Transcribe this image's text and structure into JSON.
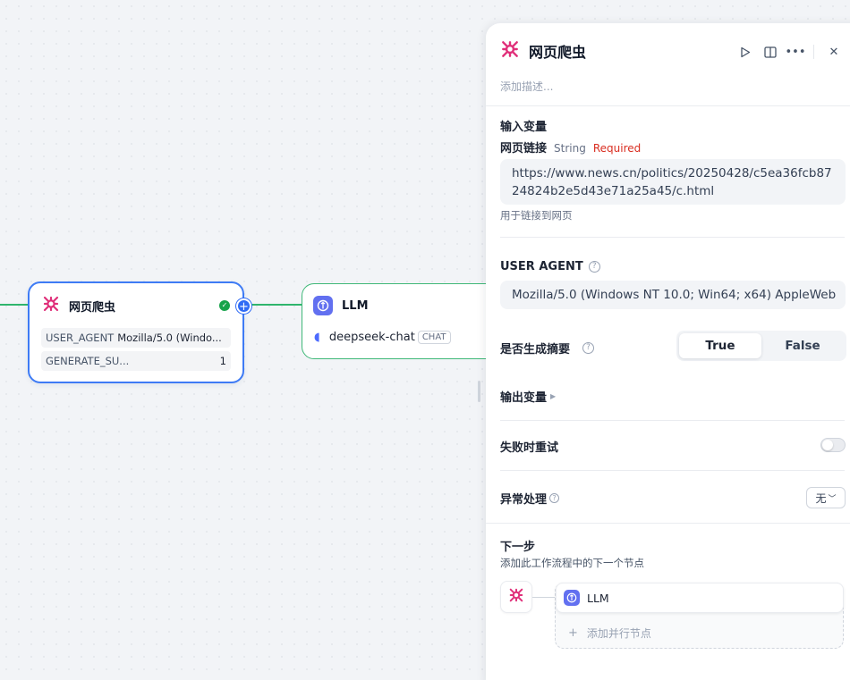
{
  "canvas": {
    "crawler_node": {
      "title": "网页爬虫",
      "status_icon": "check-circle-icon",
      "params": [
        {
          "key": "USER_AGENT",
          "value": "Mozilla/5.0 (Windo..."
        },
        {
          "key": "GENERATE_SU...",
          "value": "1"
        }
      ]
    },
    "llm_node": {
      "title": "LLM",
      "model": "deepseek-chat",
      "tag": "CHAT"
    }
  },
  "panel": {
    "title": "网页爬虫",
    "description_placeholder": "添加描述...",
    "input_section": "输入变量",
    "url_var": {
      "name": "网页链接",
      "type": "String",
      "required": "Required",
      "value": "https://www.news.cn/politics/20250428/c5ea36fcb8724824b2e5d43e71a25a45/c.html",
      "hint": "用于链接到网页"
    },
    "user_agent": {
      "label": "USER AGENT",
      "value": "Mozilla/5.0 (Windows NT 10.0; Win64; x64) AppleWeb"
    },
    "generate_summary": {
      "label": "是否生成摘要",
      "options": [
        "True",
        "False"
      ],
      "selected": "True"
    },
    "output_section": "输出变量",
    "retry_on_fail": {
      "label": "失败时重试",
      "enabled": false
    },
    "error_handling": {
      "label": "异常处理",
      "value": "无"
    },
    "next_step": {
      "title": "下一步",
      "hint": "添加此工作流程中的下一个节点",
      "nodes": [
        "LLM"
      ],
      "add_parallel": "添加并行节点"
    }
  },
  "colors": {
    "selected_border": "#3e7bf5",
    "edge": "#2fb56d",
    "crawler_icon": "#e0307a",
    "llm_icon": "#6270f0",
    "required": "#d92d20"
  }
}
